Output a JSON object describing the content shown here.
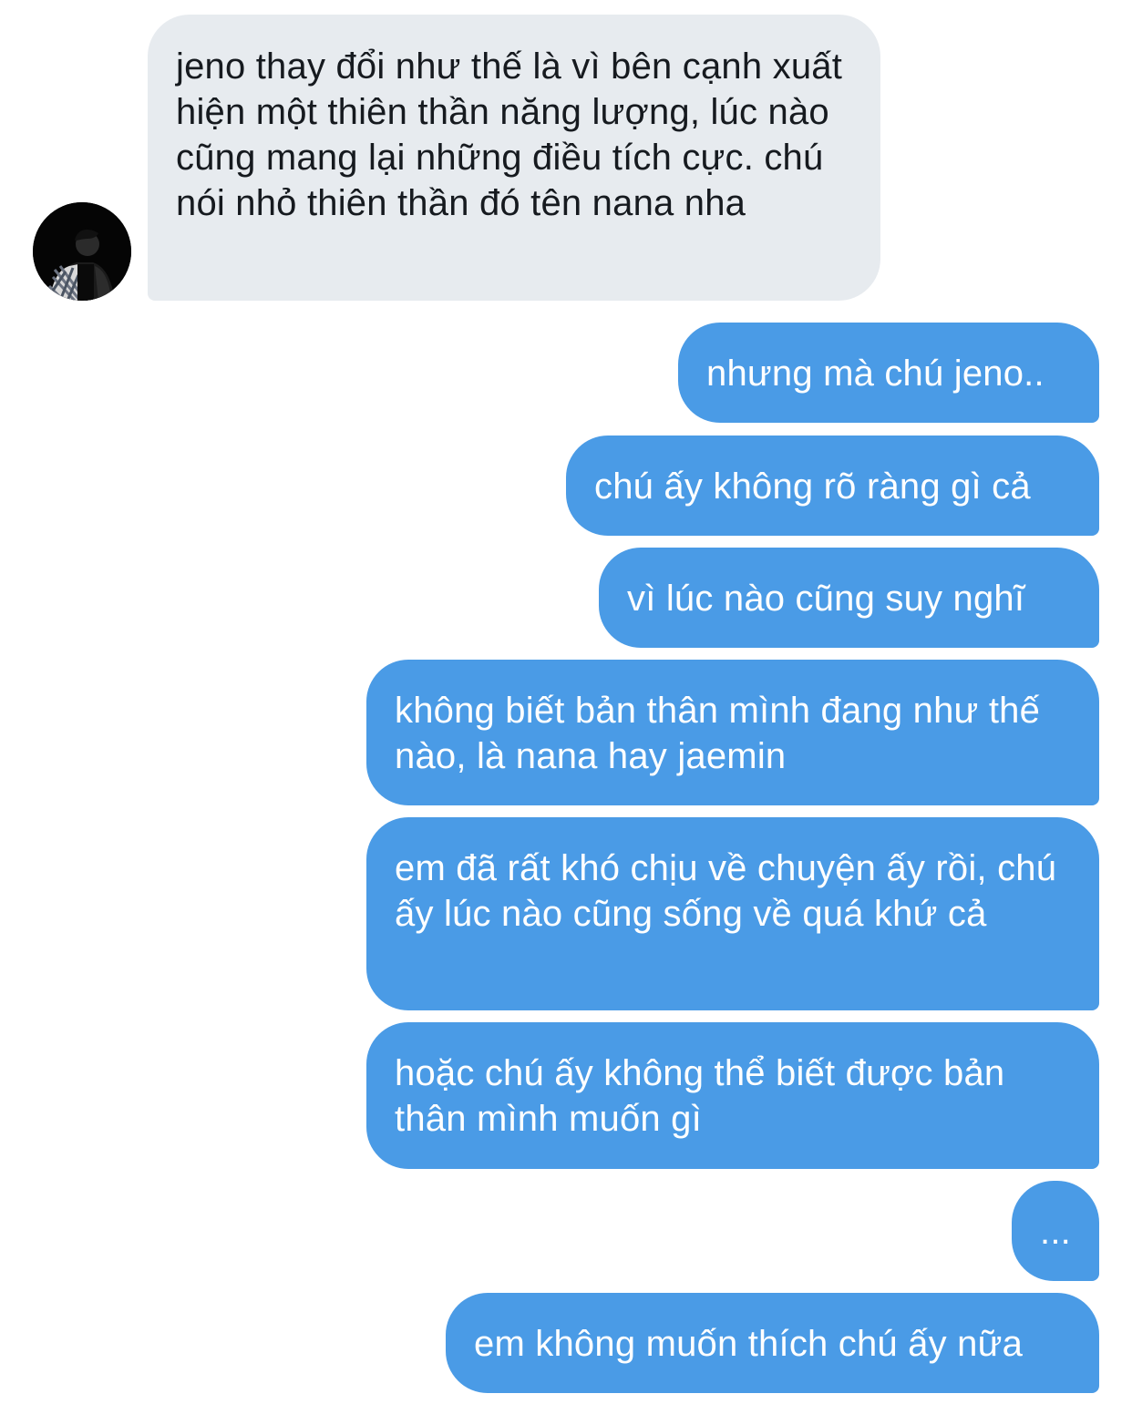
{
  "colors": {
    "incoming_bubble": "#e7ebef",
    "incoming_text": "#161a1f",
    "outgoing_bubble": "#4a9be6",
    "outgoing_text": "#ffffff"
  },
  "conversation": {
    "avatar_icon": "profile-photo",
    "messages": [
      {
        "sender": "them",
        "text": "jeno thay đổi như thế là vì bên cạnh xuất hiện một thiên thần năng lượng, lúc nào cũng mang lại những điều tích cực. chú nói nhỏ thiên thần đó tên nana nha"
      },
      {
        "sender": "me",
        "text": "nhưng mà chú jeno.."
      },
      {
        "sender": "me",
        "text": "chú ấy không rõ ràng gì cả"
      },
      {
        "sender": "me",
        "text": "vì lúc nào cũng suy nghĩ"
      },
      {
        "sender": "me",
        "text": "không biết bản thân mình đang như thế nào, là nana hay jaemin"
      },
      {
        "sender": "me",
        "text": "em đã rất khó chịu về chuyện ấy rồi, chú ấy lúc nào cũng sống về quá khứ cả"
      },
      {
        "sender": "me",
        "text": "hoặc chú ấy không thể biết được bản thân mình muốn gì"
      },
      {
        "sender": "me",
        "text": "..."
      },
      {
        "sender": "me",
        "text": "em không muốn thích chú ấy nữa"
      }
    ]
  }
}
